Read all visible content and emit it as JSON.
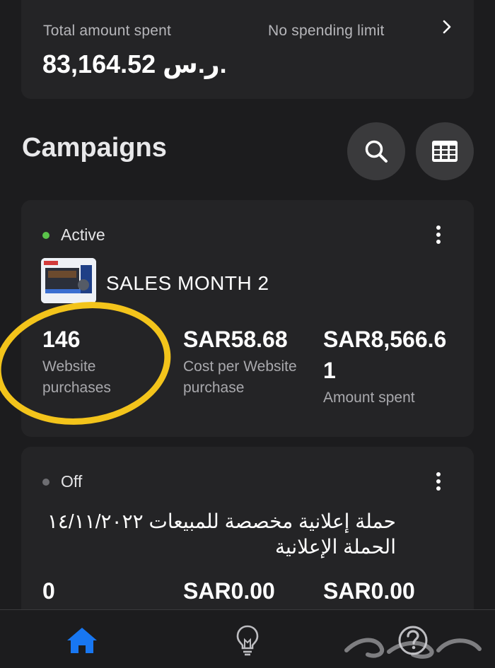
{
  "summary": {
    "total_label": "Total amount spent",
    "limit_label": "No spending limit",
    "total_amount": "83,164.52 ر.س."
  },
  "campaigns_section": {
    "title": "Campaigns"
  },
  "icons": {
    "search": "search-icon",
    "columns": "table-columns-icon",
    "more": "more-vertical-icon",
    "chevron": "chevron-right-icon",
    "home": "home-icon",
    "tips": "lightbulb-icon",
    "help": "help-icon"
  },
  "colors": {
    "background": "#1c1c1e",
    "card": "#242426",
    "active_dot": "#5ac34a",
    "off_dot": "#6e6e72",
    "nav_active": "#1877f2",
    "highlight": "#f3c41b"
  },
  "campaigns": [
    {
      "status": "Active",
      "name": "SALES MONTH 2",
      "metrics": [
        {
          "value": "146",
          "label": "Website purchases"
        },
        {
          "value": "SAR58.68",
          "label": "Cost per Website purchase"
        },
        {
          "value": "SAR8,566.61",
          "label": "Amount spent"
        }
      ]
    },
    {
      "status": "Off",
      "name": "حملة إعلانية مخصصة للمبيعات ١٤/١١/٢٠٢٢ الحملة الإعلانية",
      "metrics": [
        {
          "value": "0"
        },
        {
          "value": "SAR0.00"
        },
        {
          "value": "SAR0.00"
        }
      ]
    }
  ]
}
